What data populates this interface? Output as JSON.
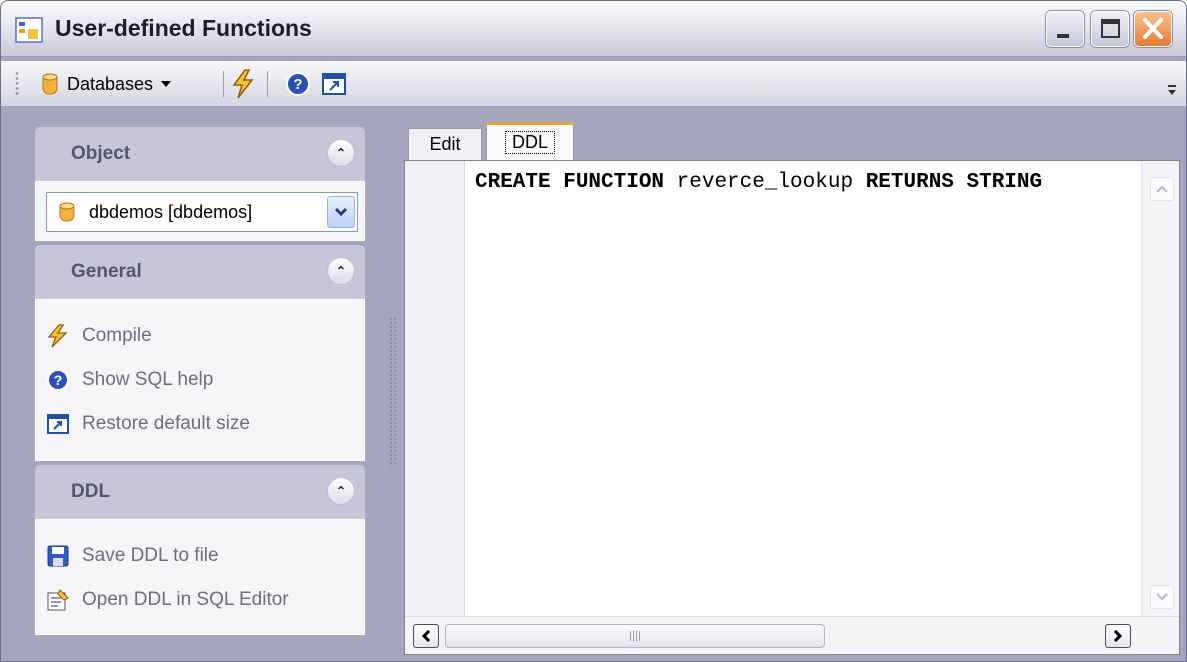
{
  "window": {
    "title": "User-defined Functions"
  },
  "toolbar": {
    "databases_label": "Databases"
  },
  "sidebar": {
    "object": {
      "title": "Object",
      "selected_database": "dbdemos [dbdemos]"
    },
    "general": {
      "title": "General",
      "items": [
        {
          "label": "Compile",
          "icon": "lightning-icon"
        },
        {
          "label": "Show SQL help",
          "icon": "help-icon"
        },
        {
          "label": "Restore default size",
          "icon": "restore-window-icon"
        }
      ]
    },
    "ddl": {
      "title": "DDL",
      "items": [
        {
          "label": "Save DDL to file",
          "icon": "floppy-disk-icon"
        },
        {
          "label": "Open DDL in SQL Editor",
          "icon": "open-in-editor-icon"
        }
      ]
    }
  },
  "tabs": {
    "edit": "Edit",
    "ddl": "DDL"
  },
  "editor": {
    "kw1": "CREATE FUNCTION",
    "name": "reverce_lookup",
    "kw2": "RETURNS STRING"
  },
  "colors": {
    "tab_highlight": "#e8a23b",
    "panel_header": "#c6c6d8",
    "window_bg": "#a5a6bd"
  }
}
